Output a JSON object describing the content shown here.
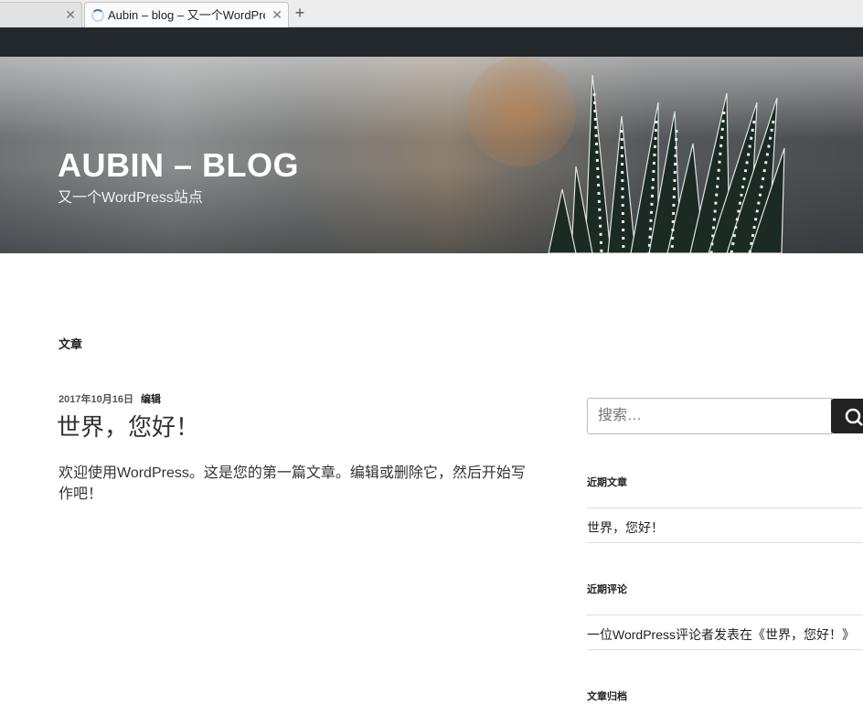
{
  "browser": {
    "tabs": [
      {
        "title": ""
      },
      {
        "title": "Aubin – blog – 又一个WordPress站点"
      }
    ]
  },
  "header": {
    "site_title": "AUBIN – BLOG",
    "site_description": "又一个WordPress站点"
  },
  "main": {
    "page_heading": "文章",
    "post": {
      "date": "2017年10月16日",
      "edit_label": "编辑",
      "title": "世界，您好！",
      "excerpt": "欢迎使用WordPress。这是您的第一篇文章。编辑或删除它，然后开始写作吧！"
    }
  },
  "sidebar": {
    "search_placeholder": "搜索…",
    "recent_posts_title": "近期文章",
    "recent_posts": [
      "世界，您好！"
    ],
    "recent_comments_title": "近期评论",
    "recent_comments": [
      "一位WordPress评论者发表在《世界，您好！》"
    ],
    "archives_title": "文章归档"
  },
  "colors": {
    "admin_bar": "#23282d",
    "search_button": "#222222",
    "text": "#333333"
  }
}
